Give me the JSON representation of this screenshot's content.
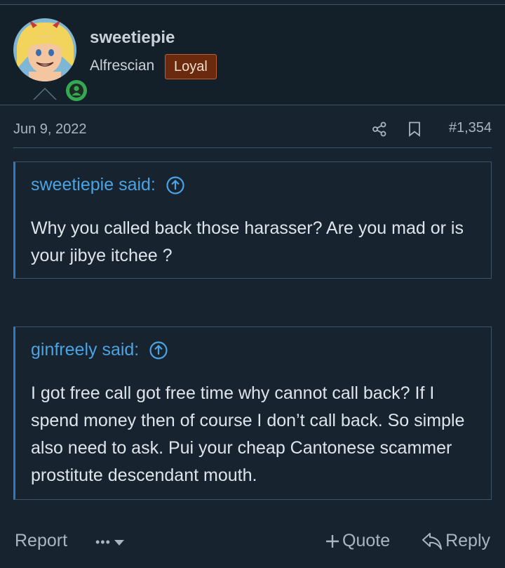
{
  "user": {
    "name": "sweetiepie",
    "title": "Alfrescian",
    "badge": "Loyal"
  },
  "post": {
    "date": "Jun 9, 2022",
    "number": "#1,354"
  },
  "quotes": [
    {
      "author": "sweetiepie said:",
      "text": "Why you called back those harasser? Are you mad or is your jibye itchee ?"
    },
    {
      "author": "ginfreely said:",
      "text": "I got free call got free time why cannot call back? If I spend money then of course I don’t call back. So simple also need to ask. Pui your cheap Cantonese scammer prostitute descendant mouth."
    }
  ],
  "actions": {
    "report": "Report",
    "more": "•••",
    "quote": "Quote",
    "reply": "Reply"
  },
  "colors": {
    "background": "#17232e",
    "link": "#4ba3e3",
    "badge": "#6b2a0e",
    "online": "#34a853",
    "quote_border": "#2e7bc4"
  }
}
